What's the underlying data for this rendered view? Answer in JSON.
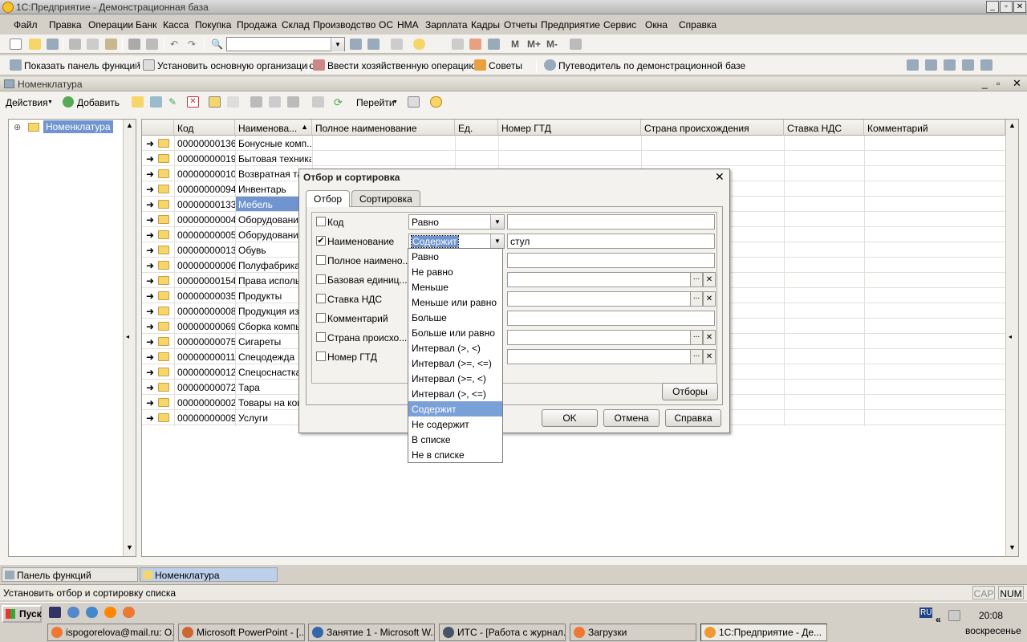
{
  "window": {
    "title": "1С:Предприятие - Демонстрационная база"
  },
  "menu": [
    "Файл",
    "Правка",
    "Операции",
    "Банк",
    "Касса",
    "Покупка",
    "Продажа",
    "Склад",
    "Производство",
    "ОС",
    "НМА",
    "Зарплата",
    "Кадры",
    "Отчеты",
    "Предприятие",
    "Сервис",
    "Окна",
    "Справка"
  ],
  "cmdbar": {
    "show_panel": "Показать панель функций",
    "set_org": "Установить основную организацию",
    "enter_op": "Ввести хозяйственную операцию",
    "tips": "Советы",
    "guide": "Путеводитель по демонстрационной базе"
  },
  "doc": {
    "title": "Номенклатура"
  },
  "actions": {
    "actions": "Действия",
    "add": "Добавить",
    "goto": "Перейти"
  },
  "tree": {
    "root": "Номенклатура"
  },
  "grid": {
    "columns": [
      "Код",
      "Наименова...",
      "Полное наименование",
      "Ед.",
      "Номер ГТД",
      "Страна происхождения",
      "Ставка НДС",
      "Комментарий"
    ],
    "rows": [
      {
        "code": "00000000136",
        "name": "Бонусные комп..."
      },
      {
        "code": "00000000019",
        "name": "Бытовая техника"
      },
      {
        "code": "00000000010",
        "name": "Возвратная та"
      },
      {
        "code": "00000000094",
        "name": "Инвентарь"
      },
      {
        "code": "00000000133",
        "name": "Мебель"
      },
      {
        "code": "00000000004",
        "name": "Оборудование"
      },
      {
        "code": "00000000005",
        "name": "Оборудование"
      },
      {
        "code": "00000000013",
        "name": "Обувь"
      },
      {
        "code": "00000000006",
        "name": "Полуфабрикат"
      },
      {
        "code": "00000000154",
        "name": "Права исполь:"
      },
      {
        "code": "00000000035",
        "name": "Продукты"
      },
      {
        "code": "00000000008",
        "name": "Продукция из"
      },
      {
        "code": "00000000069",
        "name": "Сборка компь."
      },
      {
        "code": "00000000075",
        "name": "Сигареты"
      },
      {
        "code": "00000000011",
        "name": "Спецодежда"
      },
      {
        "code": "00000000012",
        "name": "Спецоснастка"
      },
      {
        "code": "00000000072",
        "name": "Тара"
      },
      {
        "code": "00000000002",
        "name": "Товары на ком"
      },
      {
        "code": "00000000009",
        "name": "Услуги"
      }
    ]
  },
  "dialog": {
    "title": "Отбор и сортировка",
    "tabs": [
      "Отбор",
      "Сортировка"
    ],
    "fields": [
      {
        "label": "Код",
        "checked": false,
        "cond": "Равно",
        "value": "",
        "picker": false
      },
      {
        "label": "Наименование",
        "checked": true,
        "cond": "Содержит",
        "value": "стул",
        "picker": false
      },
      {
        "label": "Полное наимено...",
        "checked": false,
        "cond": "",
        "value": "",
        "picker": false
      },
      {
        "label": "Базовая единиц...",
        "checked": false,
        "cond": "",
        "value": "",
        "picker": true
      },
      {
        "label": "Ставка НДС",
        "checked": false,
        "cond": "",
        "value": "",
        "picker": true
      },
      {
        "label": "Комментарий",
        "checked": false,
        "cond": "",
        "value": "",
        "picker": false
      },
      {
        "label": "Страна происхо...",
        "checked": false,
        "cond": "",
        "value": "",
        "picker": true
      },
      {
        "label": "Номер ГТД",
        "checked": false,
        "cond": "",
        "value": "",
        "picker": true
      }
    ],
    "filters_btn": "Отборы",
    "ok": "OK",
    "cancel": "Отмена",
    "help": "Справка",
    "dropdown": [
      "Равно",
      "Не равно",
      "Меньше",
      "Меньше или равно",
      "Больше",
      "Больше или равно",
      "Интервал (>, <)",
      "Интервал (>=, <=)",
      "Интервал (>=, <)",
      "Интервал (>, <=)",
      "Содержит",
      "Не содержит",
      "В списке",
      "Не в списке"
    ],
    "dropdown_selected": "Содержит",
    "check_mark": "✔",
    "ellipsis": "...",
    "clear": "✕"
  },
  "bottom_tabs": [
    "Панель функций",
    "Номенклатура"
  ],
  "status": {
    "text": "Установить отбор и сортировку списка",
    "cap": "CAP",
    "num": "NUM"
  },
  "taskbar": {
    "start": "Пуск",
    "lang": "RU",
    "time": "20:08",
    "day": "воскресенье",
    "tasks": [
      "ispogorelova@mail.ru: О...",
      "Microsoft PowerPoint - [...",
      "Занятие 1 - Microsoft W...",
      "ИТС - [Работа с журнал...",
      "Загрузки",
      "1С:Предприятие - Де..."
    ]
  }
}
